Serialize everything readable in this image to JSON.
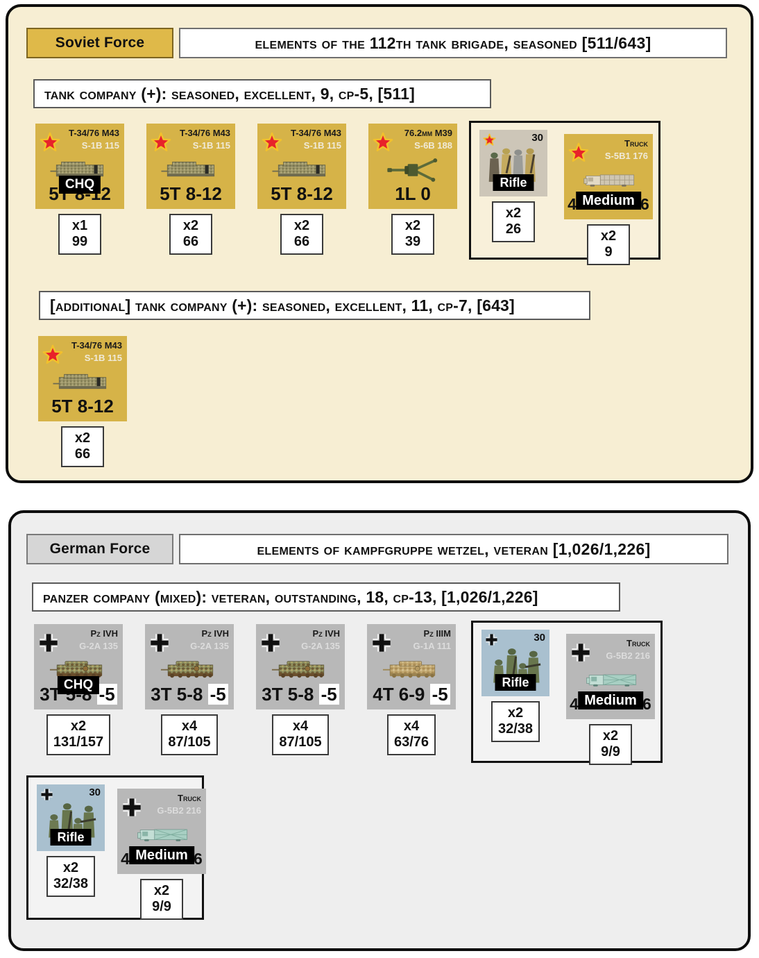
{
  "soviet": {
    "force_tag": "Soviet Force",
    "force_title": "Elements of the 112th Tank Brigade, Seasoned [511/643]",
    "formations": [
      {
        "label": "Tank Company (+): Seasoned, Excellent, 9, CP-5, [511]"
      },
      {
        "label": "[additional] Tank Company (+): Seasoned, Excellent, 11, CP-7, [643]"
      }
    ],
    "units_1": [
      {
        "name": "T-34/76 M43",
        "code": "S-1B 115",
        "stat": "5T 8-12",
        "overlay": "CHQ",
        "qty": "x1",
        "pts": "99",
        "art": "tank-soviet"
      },
      {
        "name": "T-34/76 M43",
        "code": "S-1B 115",
        "stat": "5T 8-12",
        "overlay": "",
        "qty": "x2",
        "pts": "66",
        "art": "tank-soviet"
      },
      {
        "name": "T-34/76 M43",
        "code": "S-1B 115",
        "stat": "5T 8-12",
        "overlay": "",
        "qty": "x2",
        "pts": "66",
        "art": "tank-soviet"
      },
      {
        "name": "76.2mm M39",
        "code": "S-6B 188",
        "stat": "1L 0",
        "overlay": "",
        "qty": "x2",
        "pts": "39",
        "art": "gun-soviet"
      }
    ],
    "support_1": {
      "rifle": {
        "morale": "30",
        "label": "Rifle",
        "qty": "x2",
        "pts": "26"
      },
      "truck": {
        "name": "Truck",
        "code": "S-5B1 176",
        "stat": "4W 6 12 16",
        "overlay": "Medium",
        "qty": "x2",
        "pts": "9"
      }
    },
    "units_2": [
      {
        "name": "T-34/76 M43",
        "code": "S-1B 115",
        "stat": "5T 8-12",
        "overlay": "",
        "qty": "x2",
        "pts": "66",
        "art": "tank-soviet"
      }
    ]
  },
  "german": {
    "force_tag": "German Force",
    "force_title": "Elements of Kampfgruppe Wetzel, Veteran [1,026/1,226]",
    "formations": [
      {
        "label": "Panzer Company (mixed): Veteran, Outstanding, 18, CP-13, [1,026/1,226]"
      }
    ],
    "units_1": [
      {
        "name": "Pz IVH",
        "code": "G-2A 135",
        "stat_main": "3T 5-8",
        "stat_hl": "-5",
        "overlay": "CHQ",
        "qty": "x2",
        "pts": "131/157",
        "art": "tank-pz4"
      },
      {
        "name": "Pz IVH",
        "code": "G-2A 135",
        "stat_main": "3T 5-8",
        "stat_hl": "-5",
        "overlay": "",
        "qty": "x4",
        "pts": "87/105",
        "art": "tank-pz4"
      },
      {
        "name": "Pz IVH",
        "code": "G-2A 135",
        "stat_main": "3T 5-8",
        "stat_hl": "-5",
        "overlay": "",
        "qty": "x4",
        "pts": "87/105",
        "art": "tank-pz4"
      },
      {
        "name": "Pz IIIM",
        "code": "G-1A 111",
        "stat_main": "4T 6-9",
        "stat_hl": "-5",
        "overlay": "",
        "qty": "x4",
        "pts": "63/76",
        "art": "tank-pz3"
      }
    ],
    "support_1": {
      "rifle": {
        "morale": "30",
        "label": "Rifle",
        "qty": "x2",
        "pts": "32/38"
      },
      "truck": {
        "name": "Truck",
        "code": "G-5B2 216",
        "stat": "4W 6 12 16",
        "overlay": "Medium",
        "qty": "x2",
        "pts": "9/9"
      }
    },
    "support_2": {
      "rifle": {
        "morale": "30",
        "label": "Rifle",
        "qty": "x2",
        "pts": "32/38"
      },
      "truck": {
        "name": "Truck",
        "code": "G-5B2 216",
        "stat": "4W 6 12 16",
        "overlay": "Medium",
        "qty": "x2",
        "pts": "9/9"
      }
    }
  },
  "colors": {
    "soviet_panel": "#f7eed3",
    "german_panel": "#eeeeee",
    "soviet_counter": "#d6b348",
    "german_counter": "#b8b8b8",
    "soviet_tag": "#dfb949",
    "german_tag": "#d6d6d6"
  }
}
